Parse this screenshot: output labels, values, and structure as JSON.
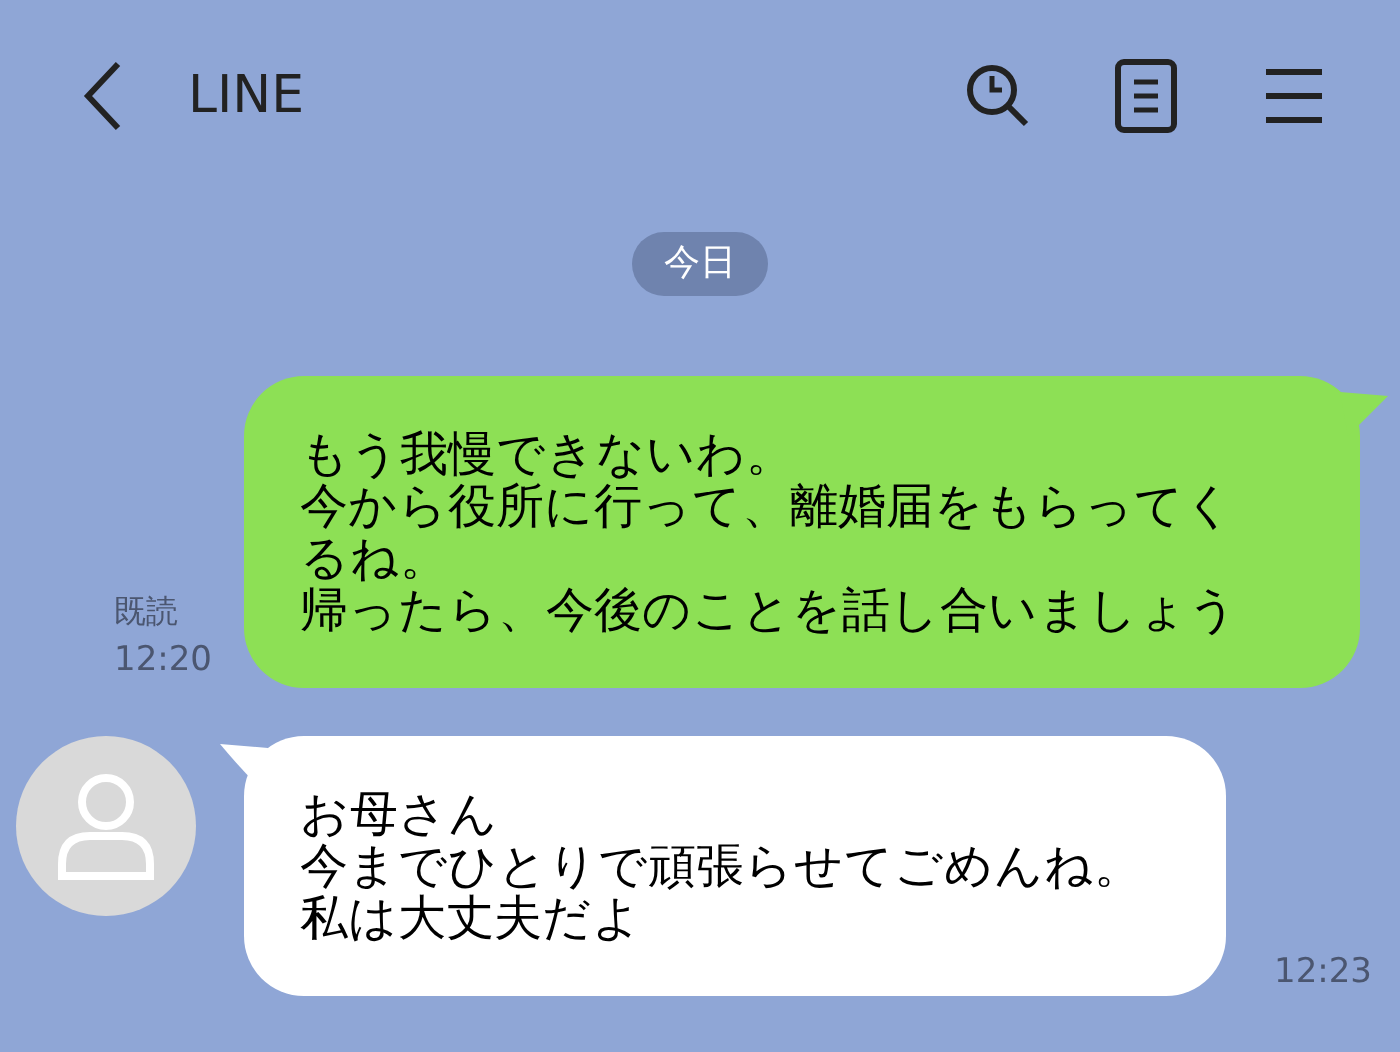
{
  "header": {
    "title": "LINE"
  },
  "date_label": "今日",
  "messages": [
    {
      "kind": "sent",
      "lines": [
        "もう我慢できないわ。",
        "今から役所に行って、離婚届をもらってく",
        "るね。",
        "帰ったら、今後のことを話し合いましょう"
      ],
      "read": "既読",
      "time": "12:20"
    },
    {
      "kind": "received",
      "lines": [
        "お母さん",
        "今までひとりで頑張らせてごめんね。",
        "私は大丈夫だよ"
      ],
      "time": "12:23"
    }
  ]
}
